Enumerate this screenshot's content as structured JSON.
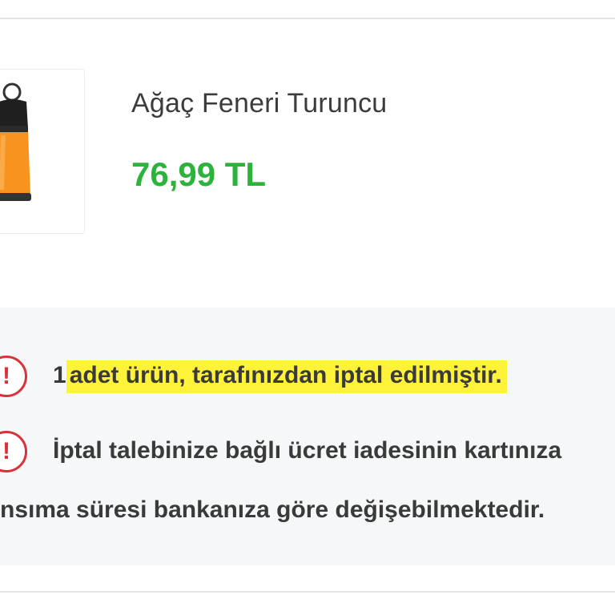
{
  "product": {
    "name": "Ağaç Feneri Turuncu",
    "price": "76,99 TL",
    "image_icon": "orange-lantern"
  },
  "notices": [
    {
      "icon": "exclamation-icon",
      "text_prefix": "1",
      "text_highlight": "adet ürün, tarafınızdan iptal edilmiştir."
    },
    {
      "icon": "exclamation-icon",
      "text": "İptal talebinize bağlı ücret iadesinin kartınıza",
      "text_continued": "nsıma süresi bankanıza göre değişebilmektedir."
    }
  ],
  "colors": {
    "price": "#2bb33b",
    "alert": "#d9323a",
    "highlight": "#fff33a",
    "panel": "#f6f7f9"
  }
}
